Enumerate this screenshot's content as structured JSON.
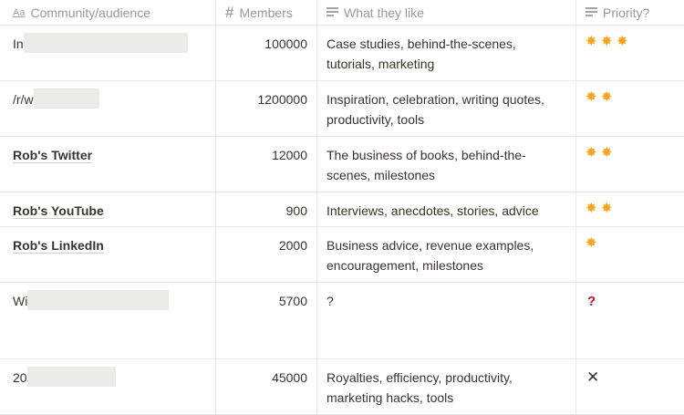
{
  "headers": {
    "community": "Community/audience",
    "community_icon": "Aa",
    "members": "Members",
    "members_icon": "#",
    "likes": "What they like",
    "priority": "Priority?"
  },
  "rows": [
    {
      "name": "In",
      "redacted": true,
      "members": "100000",
      "likes": "Case studies, behind-the-scenes, tutorials, marketing",
      "priority": "***",
      "priority_icon": "star"
    },
    {
      "name": "/r/w",
      "redacted": true,
      "members": "1200000",
      "likes": "Inspiration, celebration, writing quotes, productivity, tools",
      "priority": "**",
      "priority_icon": "star"
    },
    {
      "name": "Rob's Twitter",
      "redacted": false,
      "members": "12000",
      "likes": "The business of books, behind-the-scenes, milestones",
      "priority": "**",
      "priority_icon": "star"
    },
    {
      "name": "Rob's YouTube",
      "redacted": false,
      "members": "900",
      "likes": "Interviews, anecdotes, stories, advice",
      "priority": "**",
      "priority_icon": "star"
    },
    {
      "name": "Rob's LinkedIn",
      "redacted": false,
      "members": "2000",
      "likes": "Business advice, revenue examples, encouragement, milestones",
      "priority": "*",
      "priority_icon": "star"
    },
    {
      "name": "Wi",
      "redacted": true,
      "members": "5700",
      "likes": "?",
      "priority": "?",
      "priority_icon": "question-mark"
    },
    {
      "name": "20",
      "redacted": true,
      "members": "45000",
      "likes": "Royalties, efficiency, productivity, marketing hacks, tools",
      "priority": "X",
      "priority_icon": "cross"
    }
  ],
  "colors": {
    "star": "#f4a623",
    "question": "#c0161e",
    "border": "#e9e9e7",
    "header_text": "#9b9a97"
  }
}
